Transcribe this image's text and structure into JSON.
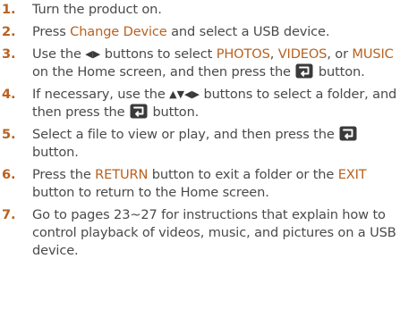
{
  "steps": [
    {
      "number": "1.",
      "parts": [
        {
          "t": "text",
          "v": "Turn the product on."
        }
      ]
    },
    {
      "number": "2.",
      "parts": [
        {
          "t": "text",
          "v": "Press "
        },
        {
          "t": "em",
          "v": "Change Device"
        },
        {
          "t": "text",
          "v": " and select a USB device."
        }
      ]
    },
    {
      "number": "3.",
      "parts": [
        {
          "t": "text",
          "v": "Use the "
        },
        {
          "t": "arrows",
          "v": "◀▶",
          "icon": "left-right-arrow-buttons-icon"
        },
        {
          "t": "text",
          "v": " buttons to select "
        },
        {
          "t": "em",
          "v": "PHOTOS"
        },
        {
          "t": "text",
          "v": ", "
        },
        {
          "t": "em",
          "v": "VIDEOS"
        },
        {
          "t": "text",
          "v": ", or "
        },
        {
          "t": "em",
          "v": "MUSIC"
        },
        {
          "t": "text",
          "v": " on the Home screen, and then press the "
        },
        {
          "t": "icon",
          "icon": "enter-button-icon"
        },
        {
          "t": "text",
          "v": " button."
        }
      ]
    },
    {
      "number": "4.",
      "parts": [
        {
          "t": "text",
          "v": "If necessary, use the "
        },
        {
          "t": "arrows",
          "v": "▲▼◀▶",
          "icon": "four-way-arrow-buttons-icon"
        },
        {
          "t": "text",
          "v": " buttons to select a folder, and then press the "
        },
        {
          "t": "icon",
          "icon": "enter-button-icon"
        },
        {
          "t": "text",
          "v": " button."
        }
      ]
    },
    {
      "number": "5.",
      "parts": [
        {
          "t": "text",
          "v": "Select a file to view or play, and then press the "
        },
        {
          "t": "icon",
          "icon": "enter-button-icon"
        },
        {
          "t": "text",
          "v": " button."
        }
      ]
    },
    {
      "number": "6.",
      "parts": [
        {
          "t": "text",
          "v": "Press the "
        },
        {
          "t": "em",
          "v": "RETURN"
        },
        {
          "t": "text",
          "v": " button to exit a folder or the "
        },
        {
          "t": "em",
          "v": "EXIT"
        },
        {
          "t": "text",
          "v": " button to return to the Home screen."
        }
      ]
    },
    {
      "number": "7.",
      "parts": [
        {
          "t": "text",
          "v": "Go to pages 23~27 for instructions that explain how to control playback of videos, music, and pictures on a USB device."
        }
      ]
    }
  ],
  "colors": {
    "accent": "#b9611e",
    "body_text": "#4a4a4a",
    "icon_fill": "#3a3a3a"
  }
}
